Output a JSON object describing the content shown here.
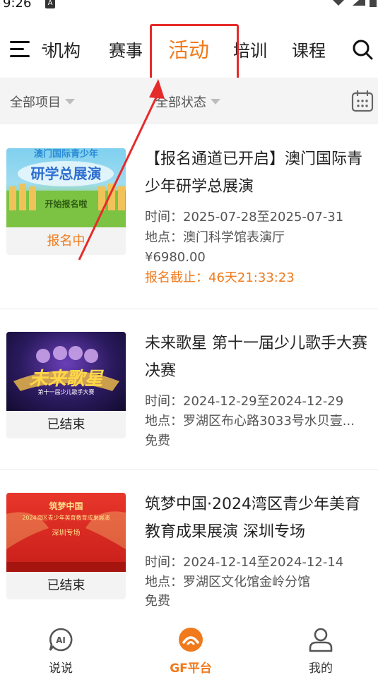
{
  "status_bar": {
    "time": "9:26",
    "notif_badge": "A"
  },
  "top_nav": {
    "tabs": [
      {
        "label": "机构",
        "partial_prefix": "专"
      },
      {
        "label": "赛事"
      },
      {
        "label": "活动"
      },
      {
        "label": "培训"
      },
      {
        "label": "课程"
      }
    ],
    "active_tab": "活动",
    "accent_color": "#f07a1c"
  },
  "filters": {
    "project": "全部项目",
    "status": "全部状态"
  },
  "events": [
    {
      "title": "【报名通道已开启】澳门国际青少年研学总展演",
      "status": "报名中",
      "time_label": "时间：",
      "time": "2025-07-28至2025-07-31",
      "place_label": "地点：",
      "place": "澳门科学馆表演厅",
      "price": "¥6980.00",
      "deadline": "报名截止：46天21:33:23",
      "poster_lines": [
        "澳门国际青少年",
        "研学总展演",
        "开始报名啦"
      ]
    },
    {
      "title": "未来歌星 第十一届少儿歌手大赛 决赛",
      "status": "已结束",
      "time_label": "时间：",
      "time": "2024-12-29至2024-12-29",
      "place_label": "地点：",
      "place": "罗湖区布心路3033号水贝壹...",
      "price": "免费",
      "poster_lines": [
        "未来歌星",
        "第十一届少儿歌手大赛"
      ]
    },
    {
      "title": "筑梦中国·2024湾区青少年美育教育成果展演 深圳专场",
      "status": "已结束",
      "time_label": "时间：",
      "time": "2024-12-14至2024-12-14",
      "place_label": "地点：",
      "place": "罗湖区文化馆金岭分馆",
      "price": "免费",
      "poster_lines": [
        "筑梦中国",
        "2024湾区青少年美育教育成果展演",
        "深圳专场"
      ]
    }
  ],
  "bottom_nav": [
    {
      "label": "说说",
      "icon": "ai-chat-icon"
    },
    {
      "label": "GF平台",
      "icon": "gf-platform-icon"
    },
    {
      "label": "我的",
      "icon": "user-icon"
    }
  ]
}
